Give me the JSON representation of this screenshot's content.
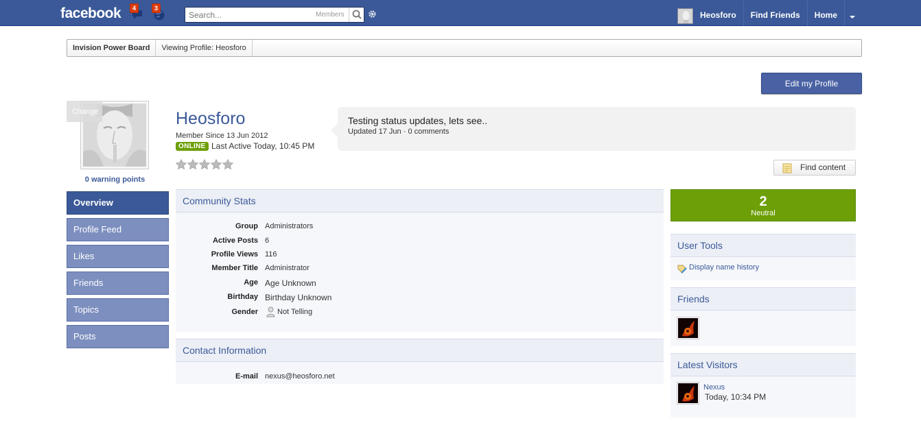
{
  "topbar": {
    "logo": "facebook",
    "messages_count": "4",
    "notifications_count": "3",
    "search": {
      "placeholder": "Search...",
      "scope": "Members"
    },
    "user_name": "Heosforo",
    "links": [
      "Find Friends",
      "Home"
    ]
  },
  "breadcrumb": [
    "Invision Power Board",
    "Viewing Profile: Heosforo"
  ],
  "edit_profile_label": "Edit my Profile",
  "avatar": {
    "change_label": "Change",
    "warning": "0 warning points"
  },
  "tabs": [
    "Overview",
    "Profile Feed",
    "Likes",
    "Friends",
    "Topics",
    "Posts"
  ],
  "profile": {
    "name": "Heosforo",
    "member_since": "Member Since 13 Jun 2012",
    "online_badge": "ONLINE",
    "last_active": "Last Active Today, 10:45 PM",
    "rating_stars": 0
  },
  "status": {
    "text": "Testing status updates, lets see..",
    "meta": "Updated 17 Jun · 0 comments"
  },
  "find_content_label": "Find content",
  "community_stats": {
    "title": "Community Stats",
    "rows": [
      {
        "label": "Group",
        "value": "Administrators"
      },
      {
        "label": "Active Posts",
        "value": "6"
      },
      {
        "label": "Profile Views",
        "value": "116"
      },
      {
        "label": "Member Title",
        "value": "Administrator"
      },
      {
        "label": "Age",
        "value": "Age Unknown"
      },
      {
        "label": "Birthday",
        "value": "Birthday Unknown"
      },
      {
        "label": "Gender",
        "value": "Not Telling"
      }
    ]
  },
  "contact": {
    "title": "Contact Information",
    "email_label": "E-mail",
    "email": "nexus@heosforo.net"
  },
  "reputation": {
    "value": "2",
    "label": "Neutral"
  },
  "user_tools": {
    "title": "User Tools",
    "item": "Display name history"
  },
  "friends": {
    "title": "Friends"
  },
  "latest_visitors": {
    "title": "Latest Visitors",
    "name": "Nexus",
    "time": "Today, 10:34 PM"
  },
  "colors": {
    "brand": "#3b5998",
    "online": "#6d9f07",
    "group": "#d10000"
  }
}
